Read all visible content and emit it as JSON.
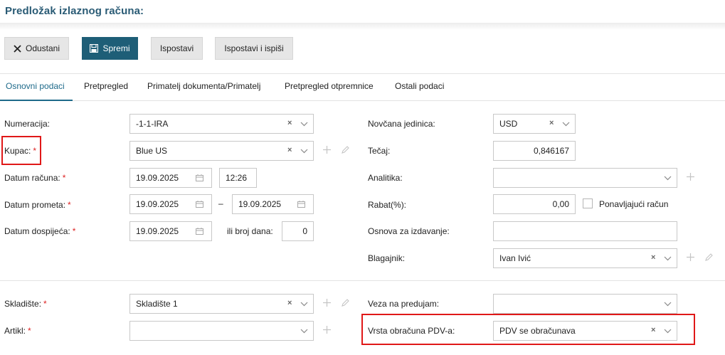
{
  "header": {
    "title": "Predložak izlaznog računa:"
  },
  "toolbar": {
    "cancel_label": "Odustani",
    "save_label": "Spremi",
    "issue_label": "Ispostavi",
    "issue_print_label": "Ispostavi i ispiši"
  },
  "tabs": [
    {
      "label": "Osnovni podaci",
      "active": true
    },
    {
      "label": "Pretpregled"
    },
    {
      "label": "Primatelj dokumenta/Primatelj"
    },
    {
      "label": "Pretpregled otpremnice"
    },
    {
      "label": "Ostali podaci"
    }
  ],
  "form": {
    "numeracija": {
      "label": "Numeracija:",
      "value": "-1-1-IRA"
    },
    "kupac": {
      "label": "Kupac:",
      "value": "Blue US",
      "required": "*"
    },
    "datum_racuna": {
      "label": "Datum računa:",
      "required": "*",
      "date": "19.09.2025",
      "time": "12:26"
    },
    "datum_prometa": {
      "label": "Datum prometa:",
      "required": "*",
      "from": "19.09.2025",
      "separator": "–",
      "to": "19.09.2025"
    },
    "datum_dospijeca": {
      "label": "Datum dospijeća:",
      "required": "*",
      "date": "19.09.2025",
      "days_label": "ili broj dana:",
      "days": "0"
    },
    "novcana_jedinica": {
      "label": "Novčana jedinica:",
      "value": "USD"
    },
    "tecaj": {
      "label": "Tečaj:",
      "value": "0,846167"
    },
    "analitika": {
      "label": "Analitika:",
      "value": ""
    },
    "rabat": {
      "label": "Rabat(%):",
      "value": "0,00",
      "recurring_label": "Ponavljajući račun"
    },
    "osnova": {
      "label": "Osnova za izdavanje:",
      "value": ""
    },
    "blagajnik": {
      "label": "Blagajnik:",
      "value": "Ivan Ivić"
    },
    "skladiste": {
      "label": "Skladište:",
      "required": "*",
      "value": "Skladište 1"
    },
    "artikl": {
      "label": "Artikl:",
      "required": "*",
      "value": ""
    },
    "veza_predujam": {
      "label": "Veza na predujam:",
      "value": ""
    },
    "vrsta_pdv": {
      "label": "Vrsta obračuna PDV-a:",
      "value": "PDV se obračunava"
    }
  },
  "colors": {
    "accent": "#1e5e77",
    "highlight": "#e01818",
    "required": "#dd2222"
  }
}
